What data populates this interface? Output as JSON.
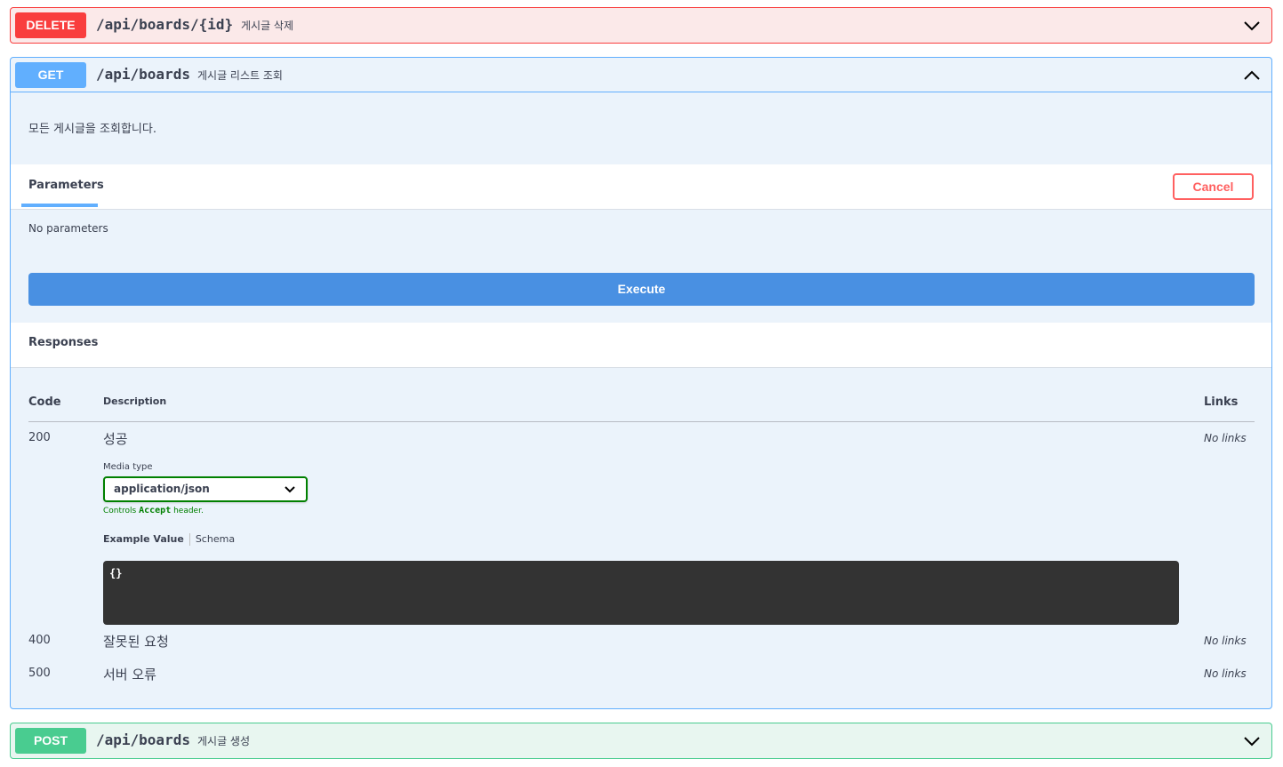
{
  "colors": {
    "delete": "#f93e3e",
    "get": "#61affe",
    "post": "#49cc90",
    "execute": "#4990e2",
    "cancel": "#ff6060",
    "media_valid": "#008000",
    "example_bg": "#333333"
  },
  "operations": [
    {
      "method": "DELETE",
      "path": "/api/boards/{id}",
      "summary": "게시글 삭제",
      "expanded": false,
      "icon": "chevron-down-icon"
    },
    {
      "method": "GET",
      "path": "/api/boards",
      "summary": "게시글 리스트 조회",
      "expanded": true,
      "icon": "chevron-up-icon"
    },
    {
      "method": "POST",
      "path": "/api/boards",
      "summary": "게시글 생성",
      "expanded": false,
      "icon": "chevron-down-icon"
    }
  ],
  "get_detail": {
    "description": "모든 게시글을 조회합니다.",
    "parameters_tab": "Parameters",
    "cancel_label": "Cancel",
    "no_parameters": "No parameters",
    "execute_label": "Execute",
    "responses_title": "Responses",
    "table_headers": {
      "code": "Code",
      "description": "Description",
      "links": "Links"
    },
    "responses": [
      {
        "code": "200",
        "description": "성공",
        "links": "No links"
      },
      {
        "code": "400",
        "description": "잘못된 요청",
        "links": "No links"
      },
      {
        "code": "500",
        "description": "서버 오류",
        "links": "No links"
      }
    ],
    "media_type_label": "Media type",
    "media_type_value": "application/json",
    "controls_prefix": "Controls ",
    "controls_code": "Accept",
    "controls_suffix": " header.",
    "example_tabs": [
      "Example Value",
      "Schema"
    ],
    "example_body": "{}"
  }
}
